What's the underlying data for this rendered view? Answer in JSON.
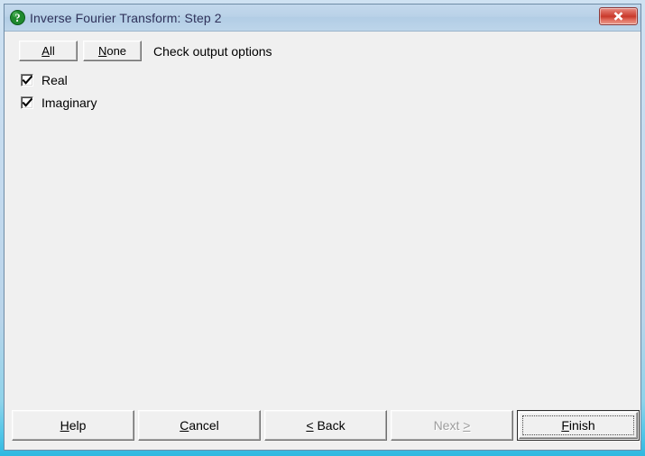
{
  "window": {
    "title": "Inverse Fourier Transform: Step 2",
    "icon": "question-mark-icon",
    "close_label": "×",
    "border_color": "#b9d4ea",
    "titlebar_color": "#bad2e8",
    "client_color": "#f0f0f0",
    "close_button_color": "#c9392b",
    "icon_color": "#1f8a2e"
  },
  "toolbar": {
    "all_button": {
      "label": "All",
      "mnemonic": "A",
      "rest": "ll"
    },
    "none_button": {
      "label": "None",
      "mnemonic": "N",
      "rest": "one"
    },
    "instruction": "Check output options"
  },
  "options": {
    "items": [
      {
        "label": "Real",
        "checked": true
      },
      {
        "label": "Imaginary",
        "checked": true
      }
    ]
  },
  "buttons": {
    "help": {
      "label": "Help",
      "mnemonic": "H",
      "prefix": "",
      "rest": "elp",
      "enabled": true,
      "default": false
    },
    "cancel": {
      "label": "Cancel",
      "mnemonic": "C",
      "prefix": "",
      "rest": "ancel",
      "enabled": true,
      "default": false
    },
    "back": {
      "label": "< Back",
      "mnemonic": "<",
      "prefix": "",
      "rest": " Back",
      "enabled": true,
      "default": false
    },
    "next": {
      "label": "Next >",
      "mnemonic": ">",
      "prefix": "Next ",
      "rest": "",
      "enabled": false,
      "default": false
    },
    "finish": {
      "label": "Finish",
      "mnemonic": "F",
      "prefix": "",
      "rest": "inish",
      "enabled": true,
      "default": true
    }
  }
}
